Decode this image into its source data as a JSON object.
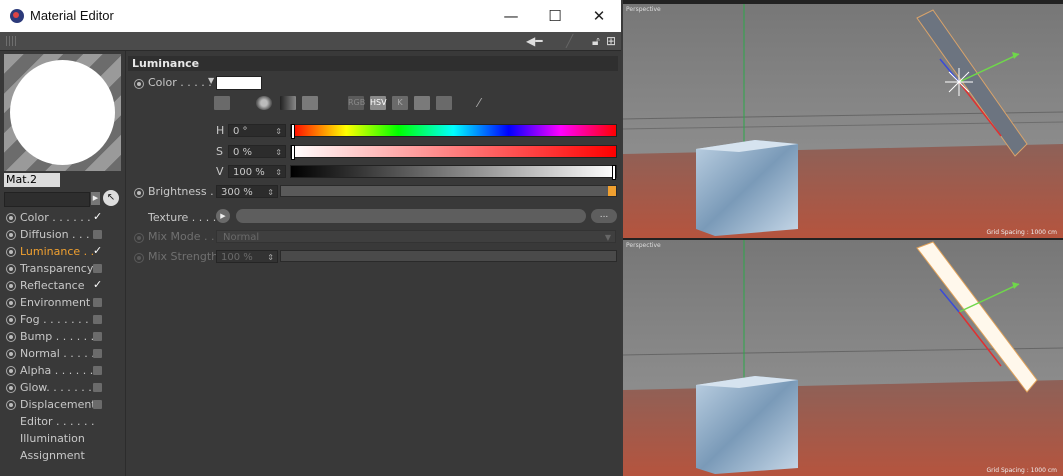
{
  "window": {
    "title": "Material Editor",
    "controls": {
      "minimize": "—",
      "maximize": "☐",
      "close": "✕"
    }
  },
  "material": {
    "name": "Mat.2",
    "channels": [
      {
        "label": "Color . . . . . .",
        "checked": true
      },
      {
        "label": "Diffusion . . . .",
        "checked": false
      },
      {
        "label": "Luminance . .",
        "checked": true,
        "active": true
      },
      {
        "label": "Transparency",
        "checked": false
      },
      {
        "label": "Reflectance",
        "checked": true
      },
      {
        "label": "Environment",
        "checked": false
      },
      {
        "label": "Fog . . . . . . . .",
        "checked": false
      },
      {
        "label": "Bump . . . . . .",
        "checked": false
      },
      {
        "label": "Normal . . . . .",
        "checked": false
      },
      {
        "label": "Alpha . . . . . .",
        "checked": false
      },
      {
        "label": "Glow. . . . . . .",
        "checked": false
      },
      {
        "label": "Displacement",
        "checked": false
      }
    ],
    "extra_items": [
      "Editor . . . . . .",
      "Illumination",
      "Assignment"
    ]
  },
  "luminance": {
    "section_title": "Luminance",
    "color_label": "Color . . . . .",
    "color_value": "#ffffff",
    "mode_buttons": [
      "RGB",
      "HSV",
      "K"
    ],
    "h_label": "H",
    "h_value": "0 °",
    "s_label": "S",
    "s_value": "0 %",
    "v_label": "V",
    "v_value": "100 %",
    "brightness_label": "Brightness . .",
    "brightness_value": "300 %",
    "texture_label": "Texture . . . . .",
    "texture_more": "...",
    "mix_mode_label": "Mix Mode . . .",
    "mix_mode_value": "Normal",
    "mix_strength_label": "Mix Strength",
    "mix_strength_value": "100 %"
  },
  "viewports": [
    {
      "label": "Perspective",
      "grid": "Grid Spacing : 1000 cm"
    },
    {
      "label": "Perspective",
      "grid": "Grid Spacing : 1000 cm"
    }
  ],
  "colors": {
    "accent": "#f0a030",
    "panel": "#393939"
  }
}
